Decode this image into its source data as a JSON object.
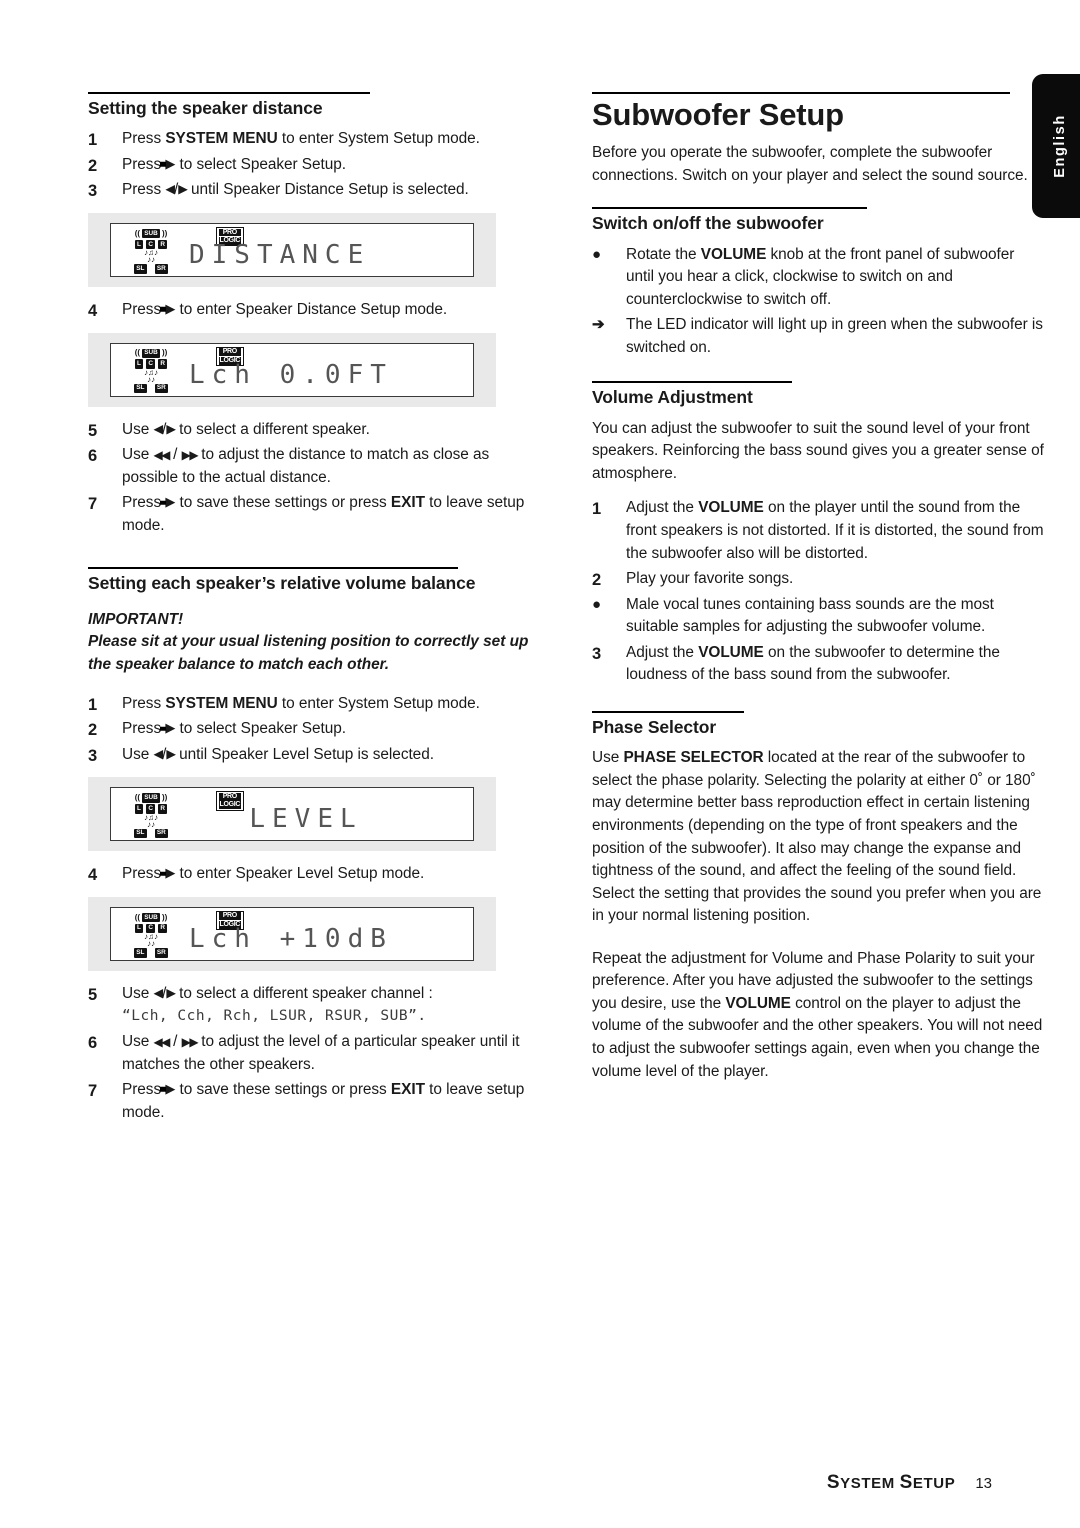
{
  "language_tab": {
    "label": "English"
  },
  "footer": {
    "section_first": "S",
    "section_rest1": "YSTEM ",
    "section_cap2": "S",
    "section_rest2": "ETUP",
    "page_number": "13"
  },
  "left_column": {
    "section1": {
      "heading": "Setting the speaker distance",
      "steps": [
        {
          "mark": "1",
          "text_parts": [
            "Press ",
            "SYSTEM MENU",
            " to enter System Setup mode."
          ]
        },
        {
          "mark": "2",
          "text_parts": [
            "Press ",
            "▶",
            " to select Speaker Setup."
          ]
        },
        {
          "mark": "3",
          "text_parts": [
            "Press ",
            "◀ / ▶",
            " until Speaker Distance Setup is selected."
          ]
        }
      ],
      "display1": {
        "text": "DISTANCE",
        "prologic_line1": "PRO",
        "prologic_line2": "LOGIC",
        "sub": "SUB",
        "l": "L",
        "c": "C",
        "r": "R",
        "sl": "SL",
        "sr": "SR"
      },
      "step4": {
        "mark": "4",
        "text": "Press ▶ to enter Speaker Distance Setup mode."
      },
      "display2": {
        "text": "Lch   0.0FT"
      },
      "steps_after": [
        {
          "mark": "5",
          "text": "Use ◀ / ▶ to select a different speaker."
        },
        {
          "mark": "6",
          "text": "Use ◀◀ / ▶▶ to adjust the distance to match as close as possible to the actual distance."
        },
        {
          "mark": "7",
          "text": "Press ▶ to save these settings or press EXIT to leave setup mode."
        }
      ]
    },
    "section2": {
      "heading": "Setting each speaker’s relative volume balance",
      "important_label": "IMPORTANT!",
      "important_body": "Please sit at your usual listening position to correctly set up the speaker balance to match each other.",
      "steps": [
        {
          "mark": "1",
          "text": "Press SYSTEM MENU to enter System Setup mode."
        },
        {
          "mark": "2",
          "text": "Press ▶ to select Speaker Setup."
        },
        {
          "mark": "3",
          "text": "Use ◀ / ▶ until Speaker Level Setup is selected."
        }
      ],
      "display1": {
        "text": "LEVEL"
      },
      "step4": {
        "mark": "4",
        "text": "Press ▶ to enter Speaker Level Setup mode."
      },
      "display2": {
        "text": "Lch  +10dB"
      },
      "step5": {
        "mark": "5",
        "text": "Use ◀ / ▶ to select a different speaker channel :",
        "channels": "“Lch, Cch, Rch, LSUR, RSUR, SUB”."
      },
      "step6": {
        "mark": "6",
        "text": "Use ◀◀ / ▶▶ to adjust the level of a particular speaker until it matches the other speakers."
      },
      "step7": {
        "mark": "7",
        "text": "Press ▶ to save these settings or press EXIT to leave setup mode."
      }
    }
  },
  "right_column": {
    "title": "Subwoofer Setup",
    "intro": "Before you operate the subwoofer, complete the subwoofer connections. Switch on your player and select the sound source.",
    "switch_section": {
      "heading": "Switch on/off the subwoofer",
      "bullet1_a": "Rotate the ",
      "bullet1_bold": "VOLUME",
      "bullet1_b": " knob at the front panel of subwoofer until you hear a click, clockwise to switch on and counterclockwise to switch off.",
      "arrow_item": "The LED indicator will light up in green when the subwoofer is switched on."
    },
    "volume_section": {
      "heading": "Volume Adjustment",
      "body": "You can adjust the subwoofer to suit the sound level of your front speakers.  Reinforcing the bass sound gives you a greater sense of atmosphere.",
      "steps": [
        {
          "mark": "1",
          "a": "Adjust the ",
          "bold": "VOLUME",
          "b": " on the player until the sound from the front speakers is not distorted. If it is distorted, the sound from the subwoofer also will be distorted."
        },
        {
          "mark": "2",
          "a": "Play your favorite songs.",
          "bold": "",
          "b": ""
        },
        {
          "mark": "●",
          "a": "Male vocal tunes containing bass sounds are the most suitable samples for adjusting the subwoofer volume.",
          "bold": "",
          "b": ""
        },
        {
          "mark": "3",
          "a": "Adjust the ",
          "bold": "VOLUME",
          "b": " on the subwoofer to determine the loudness of the bass sound from the subwoofer."
        }
      ]
    },
    "phase_section": {
      "heading": "Phase Selector",
      "para1_a": "Use ",
      "para1_bold": "PHASE SELECTOR",
      "para1_b": " located at the rear of the subwoofer to select the phase polarity. Selecting the polarity at either 0˚ or 180˚ may determine better bass reproduction effect in certain listening environments (depending on the type of front speakers and the position of the subwoofer). It also may change the expanse and tightness of the sound, and affect the feeling of the sound field.  Select the setting that provides the sound you prefer when you are in your normal listening position.",
      "para2_a": "Repeat the adjustment for Volume and Phase Polarity to suit your preference.  After you have adjusted the subwoofer to the settings you desire, use the ",
      "para2_bold": "VOLUME",
      "para2_b": " control on the player to adjust the volume of the subwoofer and the other speakers. You will not need to adjust the subwoofer settings again, even when you change the volume level of the player."
    }
  }
}
